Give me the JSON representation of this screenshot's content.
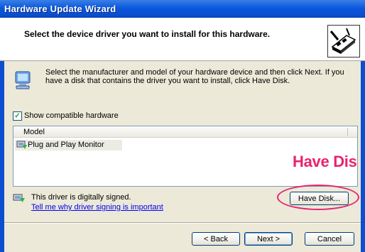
{
  "window": {
    "title": "Hardware Update Wizard"
  },
  "header": {
    "title": "Select the device driver you want to install for this hardware."
  },
  "instructions": "Select the manufacturer and model of your hardware device and then click Next. If you have a disk that contains the driver you want to install, click Have Disk.",
  "compatible": {
    "label": "Show compatible hardware",
    "checked": true
  },
  "model_list": {
    "column_header": "Model",
    "items": [
      {
        "label": "Plug and Play Monitor",
        "selected": true
      }
    ]
  },
  "overlay": {
    "label": "Have Dis"
  },
  "signing": {
    "text": "This driver is digitally signed.",
    "link": "Tell me why driver signing is important"
  },
  "buttons": {
    "have_disk": "Have Disk...",
    "back": "< Back",
    "next": "Next >",
    "cancel": "Cancel"
  },
  "colors": {
    "titlebar": "#0b4fd0",
    "highlight": "#e8236f",
    "face": "#ece9d8"
  }
}
